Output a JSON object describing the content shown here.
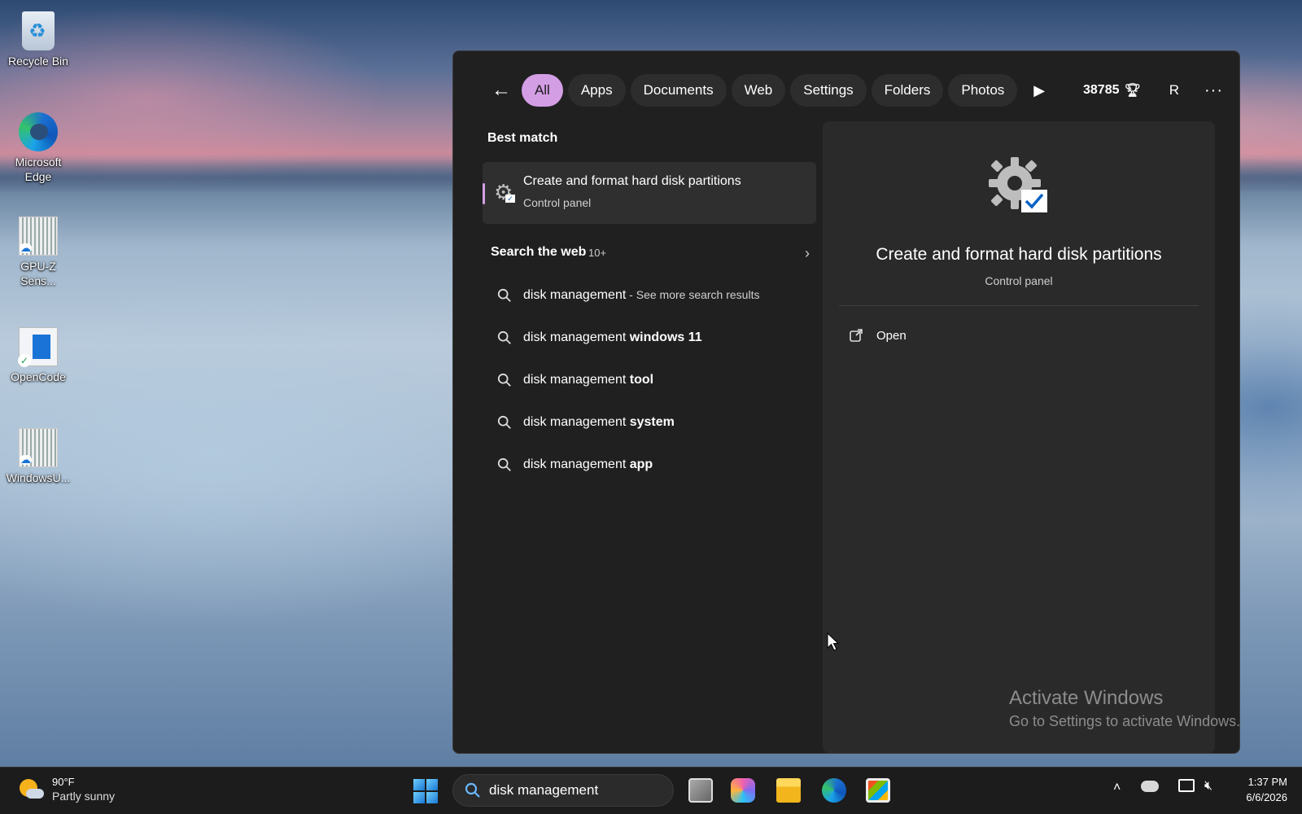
{
  "desktop": {
    "icons": [
      {
        "label": "Recycle Bin",
        "icon": "recycle-bin-icon"
      },
      {
        "label": "Microsoft Edge",
        "icon": "edge-icon"
      },
      {
        "label": "GPU-Z Sens...",
        "icon": "document-icon"
      },
      {
        "label": "OpenCode",
        "icon": "app-icon"
      },
      {
        "label": "WindowsU...",
        "icon": "document-icon"
      }
    ]
  },
  "search_panel": {
    "filters": [
      "All",
      "Apps",
      "Documents",
      "Web",
      "Settings",
      "Folders",
      "Photos"
    ],
    "active_filter": "All",
    "points": "38785",
    "avatar_initial": "R",
    "best_match_title": "Best match",
    "best_match": {
      "title": "Create and format hard disk partitions",
      "subtitle": "Control panel"
    },
    "web_section": {
      "title": "Search the web",
      "count": "10+"
    },
    "suggestions": [
      {
        "base": "disk management",
        "bold": "",
        "suffix": " - See more search results"
      },
      {
        "base": "disk management ",
        "bold": "windows 11",
        "suffix": ""
      },
      {
        "base": "disk management ",
        "bold": "tool",
        "suffix": ""
      },
      {
        "base": "disk management ",
        "bold": "system",
        "suffix": ""
      },
      {
        "base": "disk management ",
        "bold": "app",
        "suffix": ""
      }
    ],
    "preview": {
      "title": "Create and format hard disk partitions",
      "subtitle": "Control panel",
      "action_open": "Open"
    }
  },
  "watermark": {
    "line1": "Activate Windows",
    "line2": "Go to Settings to activate Windows."
  },
  "taskbar": {
    "weather_temp": "90°F",
    "weather_condition": "Partly sunny",
    "search_value": "disk management",
    "time": "1:37 PM",
    "date": "6/6/2026"
  },
  "colors": {
    "accent": "#d49ee5",
    "panel_bg": "#202020",
    "preview_bg": "#2a2a2a"
  }
}
